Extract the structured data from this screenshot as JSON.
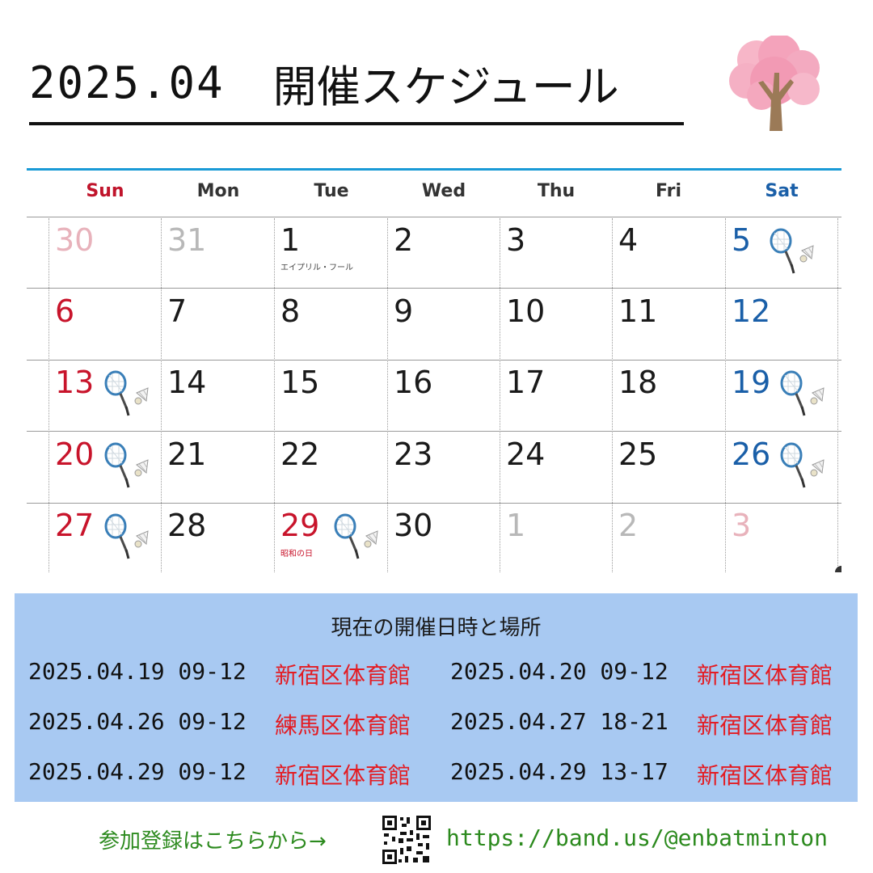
{
  "header": {
    "year_month": "2025.04",
    "title": "開催スケジュール"
  },
  "calendar": {
    "weekdays": [
      "Sun",
      "Mon",
      "Tue",
      "Wed",
      "Thu",
      "Fri",
      "Sat"
    ],
    "weeks": [
      [
        "30",
        "31",
        "1",
        "2",
        "3",
        "4",
        "5"
      ],
      [
        "6",
        "7",
        "8",
        "9",
        "10",
        "11",
        "12"
      ],
      [
        "13",
        "14",
        "15",
        "16",
        "17",
        "18",
        "19"
      ],
      [
        "20",
        "21",
        "22",
        "23",
        "24",
        "25",
        "26"
      ],
      [
        "27",
        "28",
        "29",
        "30",
        "1",
        "2",
        "3"
      ]
    ],
    "holiday_notes": {
      "april_fools": "エイプリル・フール",
      "showa_day": "昭和の日"
    },
    "event_days": [
      "5",
      "13",
      "19",
      "20",
      "26",
      "27",
      "29"
    ],
    "event_icon": "badminton-racket-shuttlecock-icon",
    "colors": {
      "sunday": "#c8142b",
      "saturday": "#1a5fa8",
      "other_month": "#b8b8b8",
      "header_rule": "#1a9ad6"
    }
  },
  "schedule": {
    "heading": "現在の開催日時と場所",
    "entries": [
      {
        "datetime": "2025.04.19 09-12",
        "venue": "新宿区体育館"
      },
      {
        "datetime": "2025.04.20 09-12",
        "venue": "新宿区体育館"
      },
      {
        "datetime": "2025.04.26 09-12",
        "venue": "練馬区体育館"
      },
      {
        "datetime": "2025.04.27 18-21",
        "venue": "新宿区体育館"
      },
      {
        "datetime": "2025.04.29 09-12",
        "venue": "新宿区体育館"
      },
      {
        "datetime": "2025.04.29 13-17",
        "venue": "新宿区体育館"
      }
    ]
  },
  "footer": {
    "register_label": "参加登録はこちらから→",
    "url": "https://band.us/@enbatminton",
    "qr_icon": "qr-code-icon"
  },
  "decoration": {
    "tree_icon": "cherry-blossom-tree-icon",
    "colors": {
      "blossom": "#f2a0b8",
      "trunk": "#9b7a57",
      "info_bg": "#a8c9f2",
      "venue_text": "#e31c23",
      "footer_text": "#2c8a1e"
    }
  }
}
